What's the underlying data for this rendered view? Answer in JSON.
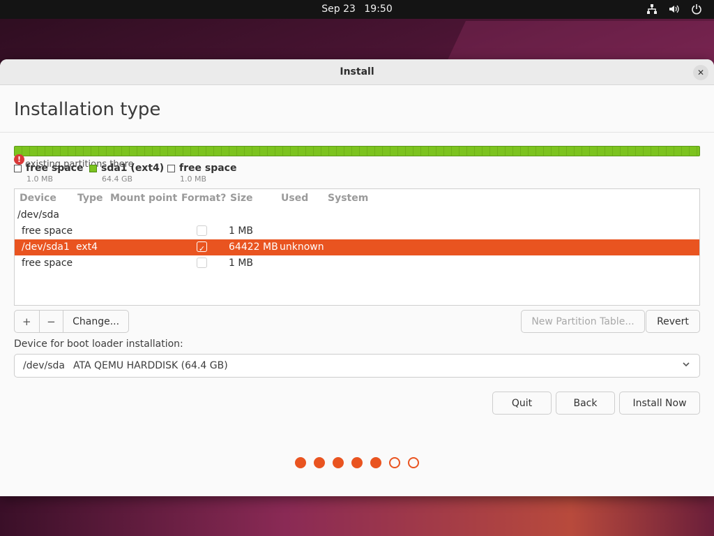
{
  "topbar": {
    "date": "Sep 23",
    "time": "19:50",
    "icons": [
      "network-icon",
      "volume-icon",
      "power-icon"
    ]
  },
  "window": {
    "title": "Install",
    "page_title": "Installation type"
  },
  "partition_bar": {
    "warning_text": "existing partitions there",
    "legend": [
      {
        "label": "free space",
        "size": "1.0 MB",
        "color": "#ffffff"
      },
      {
        "label": "sda1 (ext4)",
        "size": "64.4 GB",
        "color": "#7cc31f"
      },
      {
        "label": "free space",
        "size": "1.0 MB",
        "color": "#ffffff"
      }
    ]
  },
  "table": {
    "headers": [
      "Device",
      "Type",
      "Mount point",
      "Format?",
      "Size",
      "Used",
      "System"
    ],
    "rows": [
      {
        "device": "/dev/sda",
        "type": "",
        "mount": "",
        "format": null,
        "size": "",
        "used": "",
        "system": ""
      },
      {
        "device": "free space",
        "type": "",
        "mount": "",
        "format": false,
        "size": "1 MB",
        "used": "",
        "system": ""
      },
      {
        "device": "/dev/sda1",
        "type": "ext4",
        "mount": "",
        "format": true,
        "size": "64422 MB",
        "used": "unknown",
        "system": ""
      },
      {
        "device": "free space",
        "type": "",
        "mount": "",
        "format": false,
        "size": "1 MB",
        "used": "",
        "system": ""
      }
    ]
  },
  "partition_controls": {
    "add": "+",
    "remove": "−",
    "change": "Change...",
    "new_table": "New Partition Table...",
    "revert": "Revert"
  },
  "bootloader": {
    "label": "Device for boot loader installation:",
    "device": "/dev/sda",
    "description": "ATA QEMU HARDDISK (64.4 GB)"
  },
  "nav": {
    "quit": "Quit",
    "back": "Back",
    "install": "Install Now"
  },
  "progress": {
    "total_steps": 7,
    "completed_steps": 5
  },
  "colors": {
    "accent": "#e95420",
    "partition": "#7cc31f"
  }
}
